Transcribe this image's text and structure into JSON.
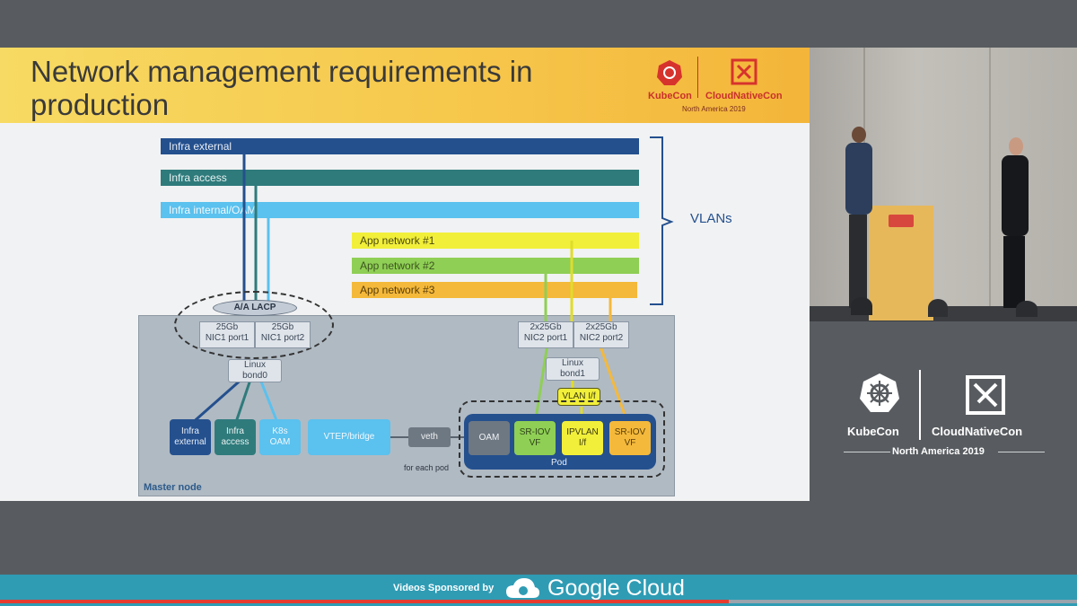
{
  "slide": {
    "title_line1": "Network management requirements in",
    "title_line2": "production",
    "header_logo": {
      "kubecon": "KubeCon",
      "cncf": "CloudNativeCon",
      "region": "North America 2019"
    },
    "vlans_label": "VLANs",
    "bars": [
      {
        "label": "Infra external",
        "color": "#24508e"
      },
      {
        "label": "Infra access",
        "color": "#2f7b7c"
      },
      {
        "label": "Infra internal/OAM",
        "color": "#5bc1ee"
      },
      {
        "label": "App network #1",
        "color": "#f2ef3a"
      },
      {
        "label": "App network #2",
        "color": "#8fcf55"
      },
      {
        "label": "App network #3",
        "color": "#f4b93b"
      }
    ],
    "lacp_label": "A/A LACP",
    "nic_ports": [
      {
        "speed": "25Gb",
        "name": "NIC1 port1"
      },
      {
        "speed": "25Gb",
        "name": "NIC1 port2"
      },
      {
        "speed": "2x25Gb",
        "name": "NIC2 port1"
      },
      {
        "speed": "2x25Gb",
        "name": "NIC2 port2"
      }
    ],
    "bond0": "Linux\nbond0",
    "bond1": "Linux\nbond1",
    "vlan_if": "VLAN I/f",
    "interfaces": {
      "infra_external": "Infra\nexternal",
      "infra_access": "Infra\naccess",
      "k8s_oam": "K8s\nOAM",
      "vtep": "VTEP/bridge",
      "veth": "veth",
      "oam": "OAM",
      "sriov1": "SR-IOV\nVF",
      "ipvlan": "IPVLAN\nI/f",
      "sriov2": "SR-IOV\nVF"
    },
    "pod_label": "Pod",
    "for_each_pod": "for each pod",
    "master_node": "Master node"
  },
  "brand": {
    "kubecon": "KubeCon",
    "cncf": "CloudNativeCon",
    "region": "North America 2019"
  },
  "footer": {
    "sponsored": "Videos Sponsored by",
    "google_cloud": "Google Cloud"
  },
  "player": {
    "progress": 0.677
  }
}
